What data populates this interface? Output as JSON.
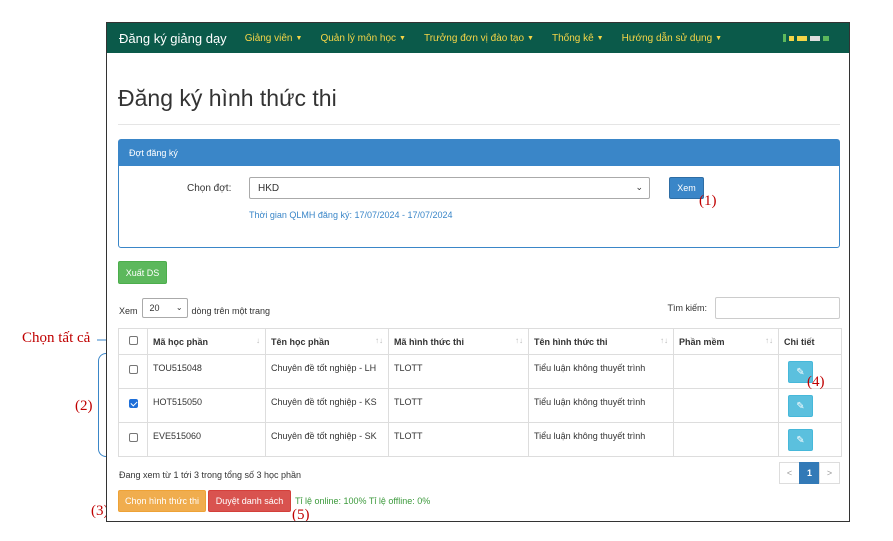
{
  "annotations": {
    "chon_tat_ca": "Chọn tất cả",
    "n1": "(1)",
    "n2": "(2)",
    "n3": "(3)",
    "n4": "(4)",
    "n5": "(5)"
  },
  "navbar": {
    "brand": "Đăng ký giảng dạy",
    "items": [
      {
        "label": "Giảng viên"
      },
      {
        "label": "Quản lý môn học"
      },
      {
        "label": "Trưởng đơn vị đào tạo"
      },
      {
        "label": "Thống kê"
      },
      {
        "label": "Hướng dẫn sử dụng"
      }
    ]
  },
  "page": {
    "title": "Đăng ký hình thức thi"
  },
  "panel": {
    "heading": "Đợt đăng ký",
    "select_label": "Chọn đợt:",
    "select_value": "HKD",
    "view_button": "Xem",
    "time_note": "Thời gian QLMH đăng ký: 17/07/2024 - 17/07/2024"
  },
  "export_button": "Xuất DS",
  "length": {
    "prefix": "Xem",
    "value": "20",
    "suffix": "dòng trên một trang"
  },
  "search": {
    "label": "Tìm kiếm:",
    "value": ""
  },
  "table": {
    "headers": [
      "Mã học phần",
      "Tên học phần",
      "Mã hình thức thi",
      "Tên hình thức thi",
      "Phần mềm",
      "Chi tiết"
    ],
    "rows": [
      {
        "checked": false,
        "code": "TOU515048",
        "name": "Chuyên đề tốt nghiệp - LH",
        "form_code": "TLOTT",
        "form_name": "Tiểu luận không thuyết trình",
        "software": ""
      },
      {
        "checked": true,
        "code": "HOT515050",
        "name": "Chuyên đề tốt nghiệp - KS",
        "form_code": "TLOTT",
        "form_name": "Tiểu luận không thuyết trình",
        "software": ""
      },
      {
        "checked": false,
        "code": "EVE515060",
        "name": "Chuyên đề tốt nghiệp - SK",
        "form_code": "TLOTT",
        "form_name": "Tiểu luận không thuyết trình",
        "software": ""
      }
    ]
  },
  "info": "Đang xem từ 1 tới 3 trong tổng số 3 học phần",
  "pager": {
    "prev": "<",
    "current": "1",
    "next": ">"
  },
  "actions": {
    "choose_button": "Chọn hình thức thi",
    "approve_button": "Duyệt danh sách",
    "ratio": "Tỉ lệ online: 100% Tỉ lệ offline: 0%"
  },
  "colors": {
    "navbar": "#0b5a4a",
    "nav_text": "#f5d547",
    "primary": "#3a86c8",
    "success": "#5cb85c",
    "warning": "#f0ad4e",
    "danger": "#d9534f",
    "info": "#5bc0de",
    "annotation": "#c00000"
  }
}
